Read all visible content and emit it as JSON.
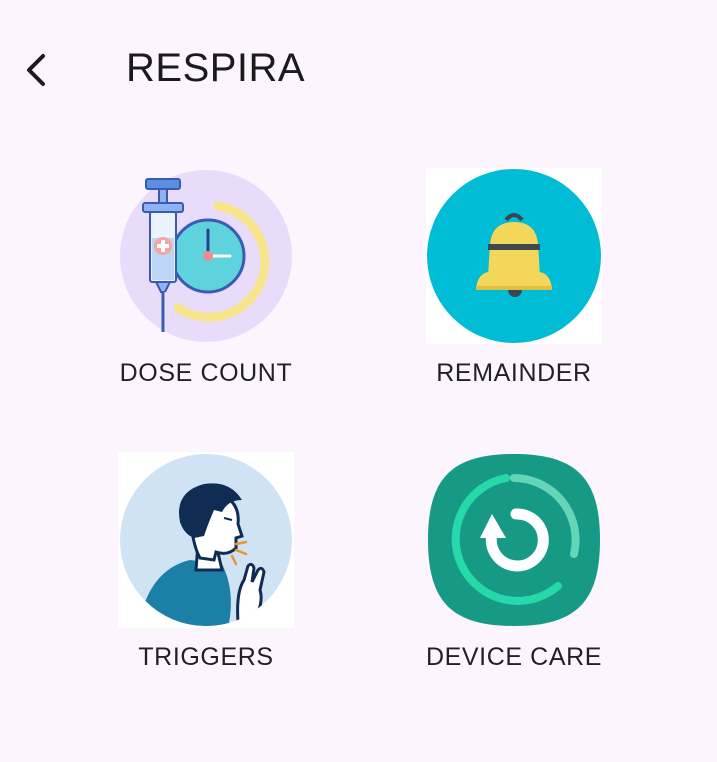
{
  "app": {
    "title": "RESPIRA"
  },
  "navigation": {
    "back_icon": "chevron-left-icon"
  },
  "menu": {
    "items": [
      {
        "label": "DOSE COUNT",
        "icon": "syringe-clock-icon"
      },
      {
        "label": "REMAINDER",
        "icon": "bell-icon"
      },
      {
        "label": "TRIGGERS",
        "icon": "coughing-person-icon"
      },
      {
        "label": "DEVICE CARE",
        "icon": "refresh-cycle-icon"
      }
    ]
  },
  "colors": {
    "background": "#fcf5fd",
    "dose_circle": "#e9dcfb",
    "reminder_circle": "#00bcd4",
    "bell": "#f4d65a",
    "triggers_circle": "#cfe3f4",
    "device_care": "#169a86"
  }
}
